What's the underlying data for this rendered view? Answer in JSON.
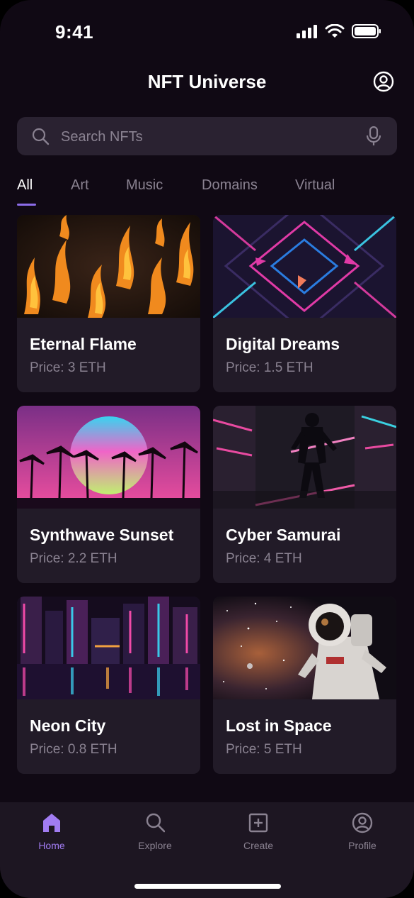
{
  "status_bar": {
    "time": "9:41"
  },
  "header": {
    "title": "NFT Universe",
    "profile_icon": "user-circle-icon"
  },
  "search": {
    "placeholder": "Search NFTs",
    "value": ""
  },
  "tabs": [
    {
      "label": "All",
      "active": true
    },
    {
      "label": "Art"
    },
    {
      "label": "Music"
    },
    {
      "label": "Domains"
    },
    {
      "label": "Virtual"
    }
  ],
  "cards": [
    {
      "name": "Eternal Flame",
      "price": "Price: 3 ETH"
    },
    {
      "name": "Digital Dreams",
      "price": "Price: 1.5 ETH"
    },
    {
      "name": "Synthwave Sunset",
      "price": "Price: 2.2 ETH"
    },
    {
      "name": "Cyber Samurai",
      "price": "Price: 4 ETH"
    },
    {
      "name": "Neon City",
      "price": "Price: 0.8 ETH"
    },
    {
      "name": "Lost in Space",
      "price": "Price: 5 ETH"
    }
  ],
  "bottom_nav": [
    {
      "label": "Home",
      "icon": "home-icon",
      "active": true
    },
    {
      "label": "Explore",
      "icon": "search-icon"
    },
    {
      "label": "Create",
      "icon": "plus-square-icon"
    },
    {
      "label": "Profile",
      "icon": "user-circle-icon"
    }
  ],
  "colors": {
    "background": "#100914",
    "card": "#221b28",
    "accent": "#8c6ce8",
    "muted": "#8a8291"
  }
}
